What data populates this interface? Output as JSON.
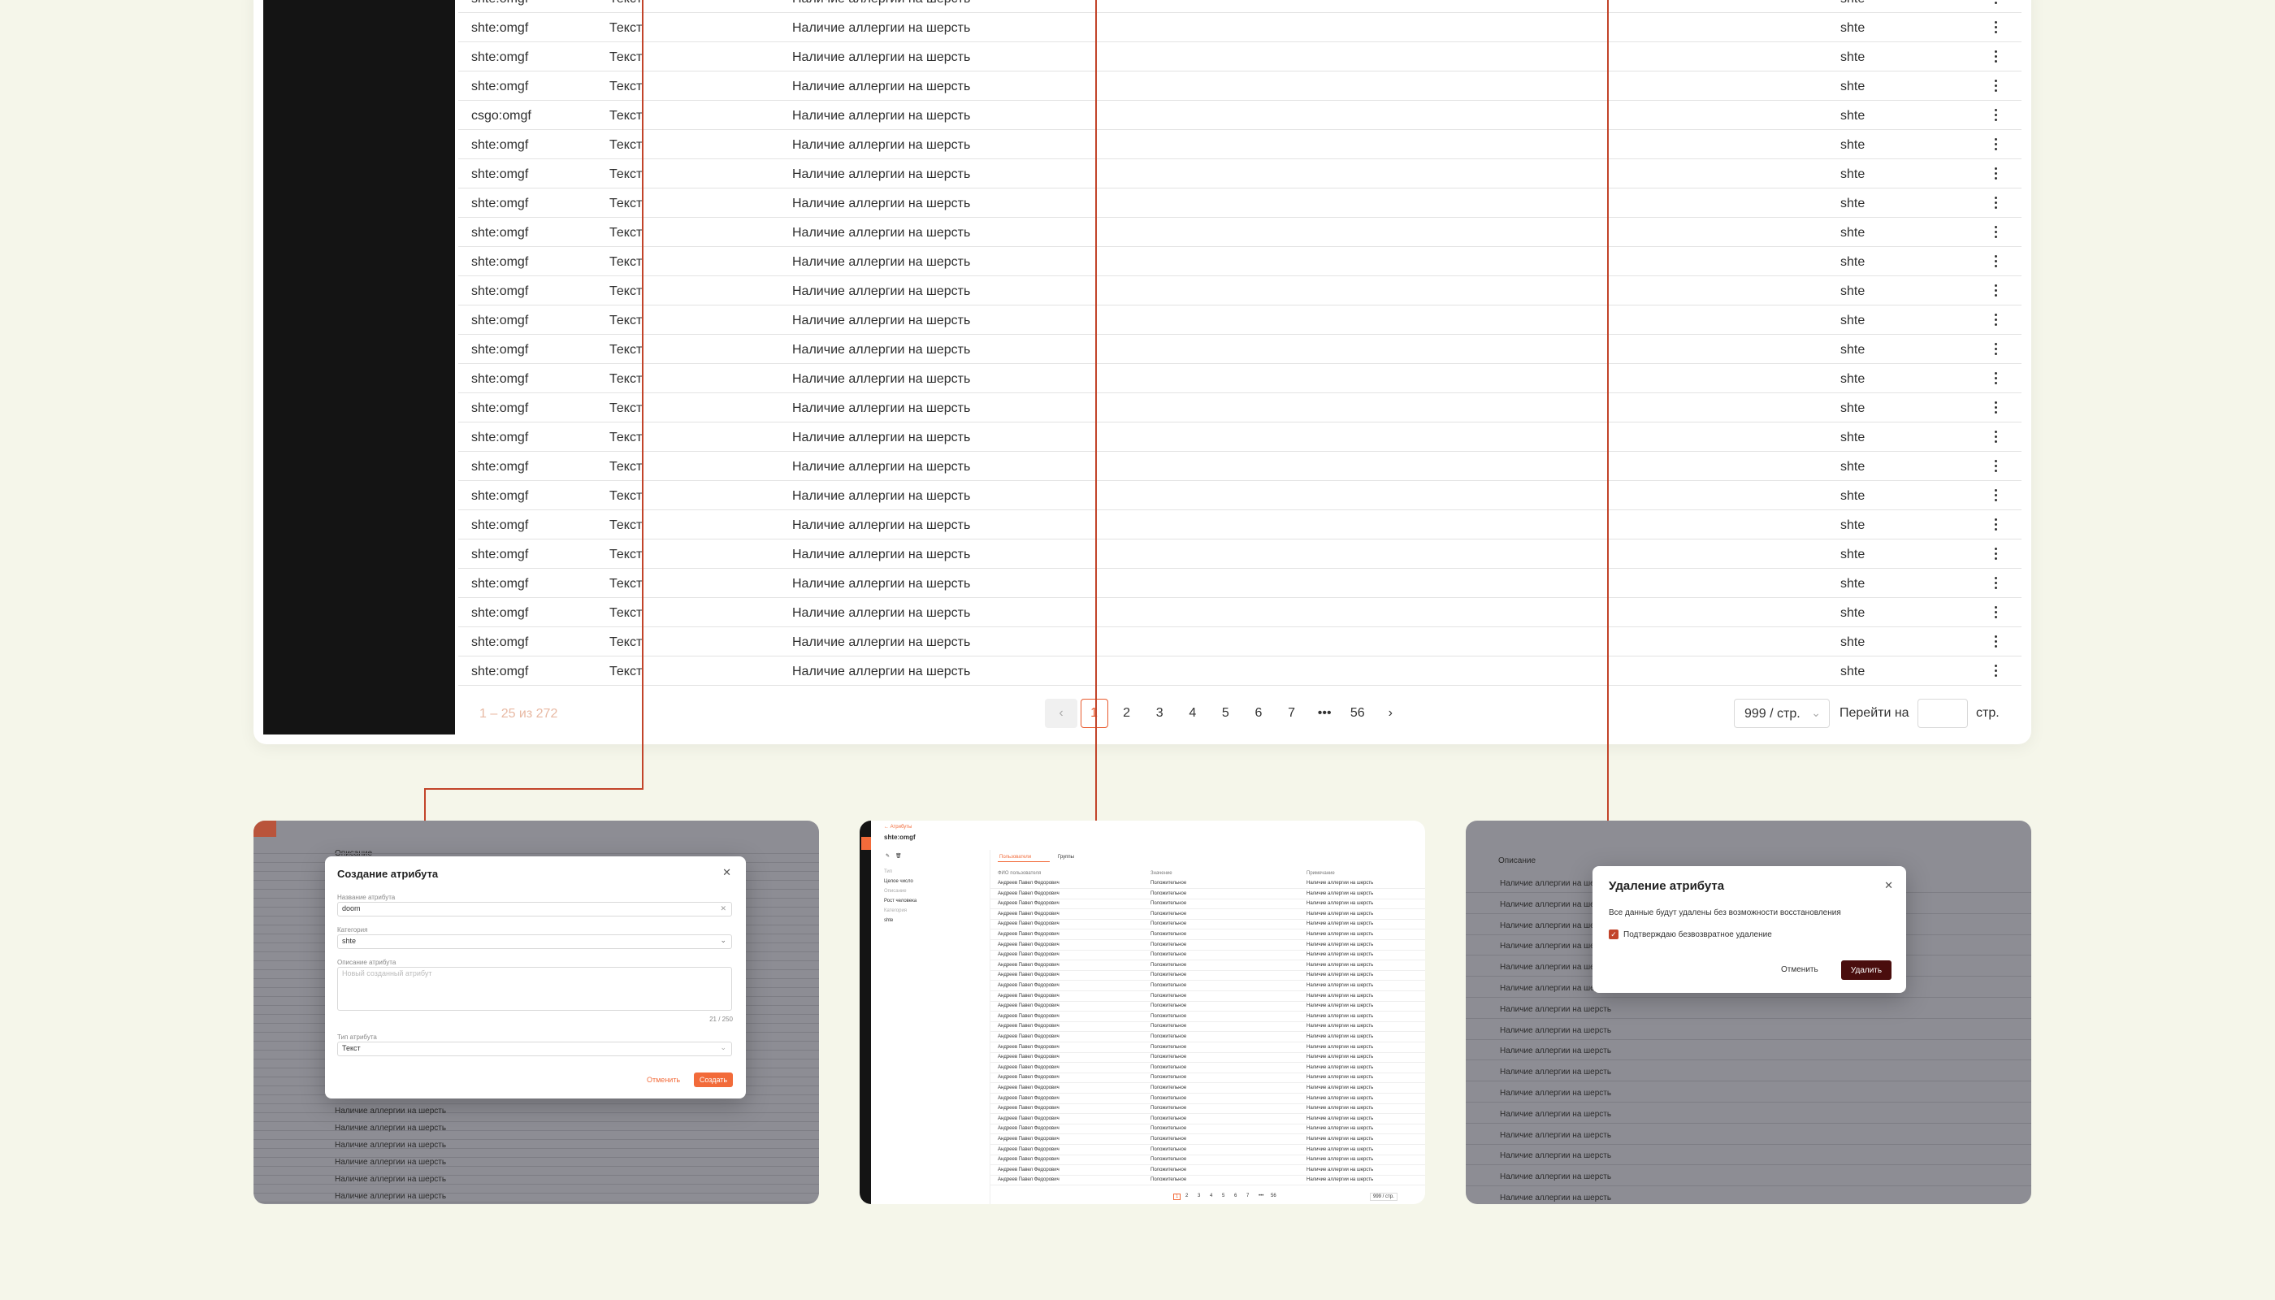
{
  "table": {
    "rows": [
      {
        "code": "shte:omgf",
        "type": "Текст",
        "description": "Наличие аллергии на шерсть",
        "category": "shte"
      },
      {
        "code": "shte:omgf",
        "type": "Текст",
        "description": "Наличие аллергии на шерсть",
        "category": "shte"
      },
      {
        "code": "shte:omgf",
        "type": "Текст",
        "description": "Наличие аллергии на шерсть",
        "category": "shte"
      },
      {
        "code": "shte:omgf",
        "type": "Текст",
        "description": "Наличие аллергии на шерсть",
        "category": "shte"
      },
      {
        "code": "csgo:omgf",
        "type": "Текст",
        "description": "Наличие аллергии на шерсть",
        "category": "shte"
      },
      {
        "code": "shte:omgf",
        "type": "Текст",
        "description": "Наличие аллергии на шерсть",
        "category": "shte"
      },
      {
        "code": "shte:omgf",
        "type": "Текст",
        "description": "Наличие аллергии на шерсть",
        "category": "shte"
      },
      {
        "code": "shte:omgf",
        "type": "Текст",
        "description": "Наличие аллергии на шерсть",
        "category": "shte"
      },
      {
        "code": "shte:omgf",
        "type": "Текст",
        "description": "Наличие аллергии на шерсть",
        "category": "shte"
      },
      {
        "code": "shte:omgf",
        "type": "Текст",
        "description": "Наличие аллергии на шерсть",
        "category": "shte"
      },
      {
        "code": "shte:omgf",
        "type": "Текст",
        "description": "Наличие аллергии на шерсть",
        "category": "shte"
      },
      {
        "code": "shte:omgf",
        "type": "Текст",
        "description": "Наличие аллергии на шерсть",
        "category": "shte"
      },
      {
        "code": "shte:omgf",
        "type": "Текст",
        "description": "Наличие аллергии на шерсть",
        "category": "shte"
      },
      {
        "code": "shte:omgf",
        "type": "Текст",
        "description": "Наличие аллергии на шерсть",
        "category": "shte"
      },
      {
        "code": "shte:omgf",
        "type": "Текст",
        "description": "Наличие аллергии на шерсть",
        "category": "shte"
      },
      {
        "code": "shte:omgf",
        "type": "Текст",
        "description": "Наличие аллергии на шерсть",
        "category": "shte"
      },
      {
        "code": "shte:omgf",
        "type": "Текст",
        "description": "Наличие аллергии на шерсть",
        "category": "shte"
      },
      {
        "code": "shte:omgf",
        "type": "Текст",
        "description": "Наличие аллергии на шерсть",
        "category": "shte"
      },
      {
        "code": "shte:omgf",
        "type": "Текст",
        "description": "Наличие аллергии на шерсть",
        "category": "shte"
      },
      {
        "code": "shte:omgf",
        "type": "Текст",
        "description": "Наличие аллергии на шерсть",
        "category": "shte"
      },
      {
        "code": "shte:omgf",
        "type": "Текст",
        "description": "Наличие аллергии на шерсть",
        "category": "shte"
      },
      {
        "code": "shte:omgf",
        "type": "Текст",
        "description": "Наличие аллергии на шерсть",
        "category": "shte"
      },
      {
        "code": "shte:omgf",
        "type": "Текст",
        "description": "Наличие аллергии на шерсть",
        "category": "shte"
      },
      {
        "code": "shte:omgf",
        "type": "Текст",
        "description": "Наличие аллергии на шерсть",
        "category": "shte"
      }
    ]
  },
  "pagination": {
    "range": "1 – 25 из 272",
    "pages": [
      "1",
      "2",
      "3",
      "4",
      "5",
      "6",
      "7",
      "•••",
      "56"
    ],
    "current": "1",
    "page_size": "999 / стр.",
    "goto_label": "Перейти на",
    "goto_suffix": "стр."
  },
  "create_modal": {
    "title": "Создание атрибута",
    "name_label": "Название атрибута",
    "name_value": "doom",
    "category_label": "Категория",
    "category_value": "shte",
    "description_label": "Описание атрибута",
    "description_placeholder": "Новый созданный атрибут",
    "counter": "21 / 250",
    "type_label": "Тип атрибута",
    "type_value": "Текст",
    "cancel_label": "Отменить",
    "submit_label": "Создать",
    "bg_header": "Описание",
    "bg_rows": [
      "Наличие аллергии на шерсть",
      "Наличие аллергии на шерсть",
      "Наличие аллергии на шерсть",
      "Наличие аллергии на шерсть",
      "Наличие аллергии на шерсть",
      "Наличие аллергии на шерсть"
    ]
  },
  "detail_view": {
    "back_link": "← Атрибуты",
    "title": "shte:omgf",
    "tabs": [
      "Пользователи",
      "Группы"
    ],
    "side_labels": [
      "Тип",
      "Целое число",
      "Описание",
      "Рост человека",
      "Категория",
      "shte"
    ],
    "columns": [
      "ФИО пользователя",
      "Значение",
      "Примечание"
    ],
    "row": {
      "name": "Андреев Павел Федорович",
      "value": "Положительное",
      "note": "Наличие аллергии на шерсть"
    },
    "page_size": "999 / стр."
  },
  "delete_modal": {
    "title": "Удаление атрибута",
    "message": "Все данные будут удалены без возможности восстановления",
    "checkbox_label": "Подтверждаю безвозвратное удаление",
    "cancel_label": "Отменить",
    "delete_label": "Удалить",
    "bg_header": "Описание",
    "bg_row": "Наличие аллергии на шерсть"
  },
  "colors": {
    "accent": "#f26b3a",
    "connector": "#c2442a",
    "danger": "#4a0d0d",
    "background": "#f5f6ea"
  }
}
